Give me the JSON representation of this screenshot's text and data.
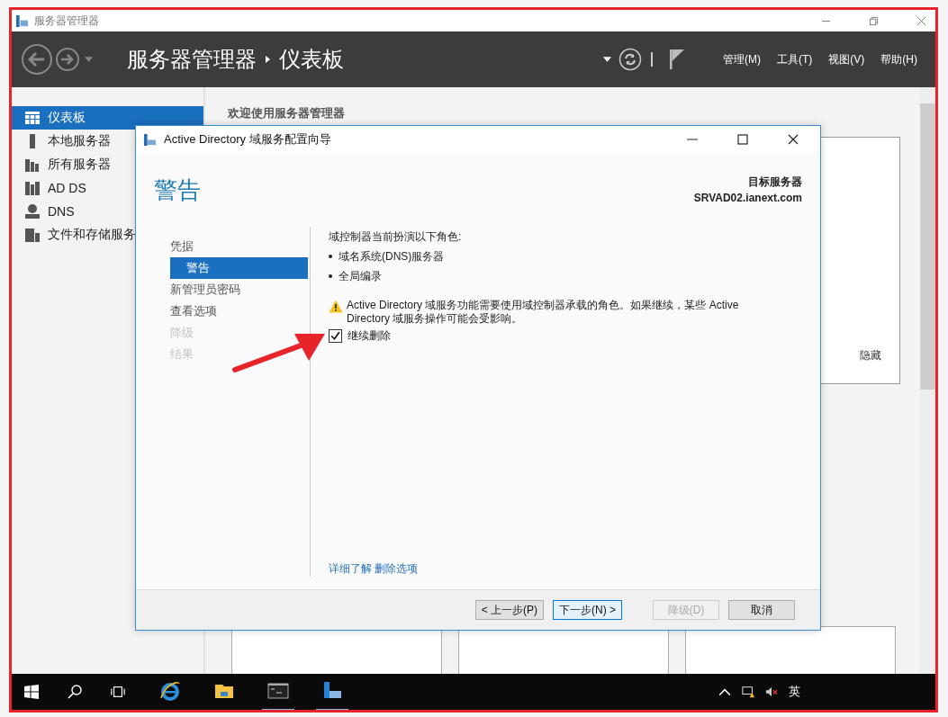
{
  "window": {
    "title": "服务器管理器"
  },
  "header": {
    "breadcrumb": [
      "服务器管理器",
      "仪表板"
    ],
    "menus": [
      "管理(M)",
      "工具(T)",
      "视图(V)",
      "帮助(H)"
    ]
  },
  "sidebar": {
    "items": [
      {
        "label": "仪表板",
        "kind": "dashboard",
        "selected": true
      },
      {
        "label": "本地服务器",
        "kind": "server",
        "selected": false
      },
      {
        "label": "所有服务器",
        "kind": "servers",
        "selected": false
      },
      {
        "label": "AD DS",
        "kind": "adds",
        "selected": false
      },
      {
        "label": "DNS",
        "kind": "dns",
        "selected": false
      },
      {
        "label": "文件和存储服务",
        "kind": "storage",
        "selected": false
      }
    ]
  },
  "main": {
    "welcome": "欢迎使用服务器管理器",
    "hide_link": "隐藏"
  },
  "dialog": {
    "title": "Active Directory 域服务配置向导",
    "heading": "警告",
    "target_label": "目标服务器",
    "target_server": "SRVAD02.ianext.com",
    "steps": [
      {
        "label": "凭据",
        "selected": false,
        "disabled": false
      },
      {
        "label": "警告",
        "selected": true,
        "disabled": false
      },
      {
        "label": "新管理员密码",
        "selected": false,
        "disabled": false
      },
      {
        "label": "查看选项",
        "selected": false,
        "disabled": false
      },
      {
        "label": "降级",
        "selected": false,
        "disabled": true
      },
      {
        "label": "结果",
        "selected": false,
        "disabled": true
      }
    ],
    "roles_intro": "域控制器当前扮演以下角色:",
    "roles": [
      "域名系统(DNS)服务器",
      "全局编录"
    ],
    "warning": "Active Directory 域服务功能需要使用域控制器承载的角色。如果继续，某些 Active Directory 域服务操作可能会受影响。",
    "confirm": {
      "label": "继续删除",
      "checked": true
    },
    "more_link": "详细了解 删除选项",
    "buttons": [
      {
        "label": "< 上一步(P)",
        "default": false,
        "disabled": false
      },
      {
        "label": "下一步(N) >",
        "default": true,
        "disabled": false
      },
      {
        "label": "降级(D)",
        "default": false,
        "disabled": true
      },
      {
        "label": "取消",
        "default": false,
        "disabled": false
      }
    ]
  },
  "taskbar": {
    "ime": "英"
  }
}
